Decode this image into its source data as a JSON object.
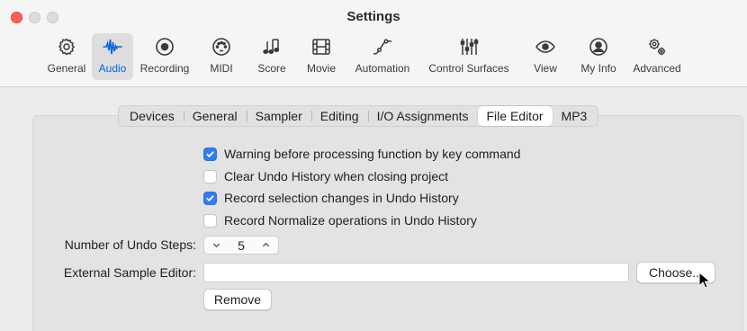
{
  "window": {
    "title": "Settings",
    "accent": "#0a64d8"
  },
  "toolbar": {
    "items": [
      {
        "label": "General",
        "icon": "gear-icon"
      },
      {
        "label": "Audio",
        "icon": "waveform-icon",
        "active": true
      },
      {
        "label": "Recording",
        "icon": "record-icon"
      },
      {
        "label": "MIDI",
        "icon": "midi-port-icon"
      },
      {
        "label": "Score",
        "icon": "music-notes-icon"
      },
      {
        "label": "Movie",
        "icon": "film-icon"
      },
      {
        "label": "Automation",
        "icon": "automation-curve-icon"
      },
      {
        "label": "Control Surfaces",
        "icon": "faders-icon"
      },
      {
        "label": "View",
        "icon": "eye-icon"
      },
      {
        "label": "My Info",
        "icon": "person-icon"
      },
      {
        "label": "Advanced",
        "icon": "gears-icon"
      }
    ]
  },
  "tabs": [
    {
      "label": "Devices"
    },
    {
      "label": "General"
    },
    {
      "label": "Sampler"
    },
    {
      "label": "Editing"
    },
    {
      "label": "I/O Assignments"
    },
    {
      "label": "File Editor",
      "active": true
    },
    {
      "label": "MP3"
    }
  ],
  "options": [
    {
      "label": "Warning before processing function by key command",
      "checked": true
    },
    {
      "label": "Clear Undo History when closing project",
      "checked": false
    },
    {
      "label": "Record selection changes in Undo History",
      "checked": true
    },
    {
      "label": "Record Normalize operations in Undo History",
      "checked": false
    }
  ],
  "undo_steps": {
    "label": "Number of Undo Steps:",
    "value": "5"
  },
  "external_editor": {
    "label": "External Sample Editor:",
    "value": "",
    "choose_label": "Choose...",
    "remove_label": "Remove"
  }
}
